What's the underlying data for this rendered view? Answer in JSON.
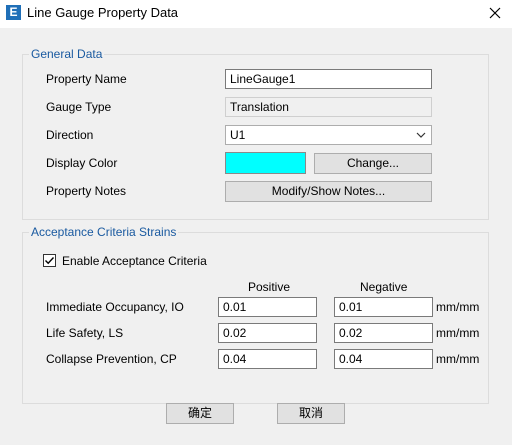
{
  "window": {
    "title": "Line Gauge Property Data",
    "app_icon_letter": "E"
  },
  "general": {
    "legend": "General Data",
    "property_name_label": "Property Name",
    "property_name_value": "LineGauge1",
    "gauge_type_label": "Gauge Type",
    "gauge_type_value": "Translation",
    "direction_label": "Direction",
    "direction_value": "U1",
    "display_color_label": "Display Color",
    "display_color": "#00ffff",
    "change_button": "Change...",
    "property_notes_label": "Property Notes",
    "notes_button": "Modify/Show Notes..."
  },
  "acceptance": {
    "legend": "Acceptance Criteria Strains",
    "enable_label": "Enable Acceptance Criteria",
    "enable_checked": true,
    "positive_header": "Positive",
    "negative_header": "Negative",
    "rows": [
      {
        "label": "Immediate Occupancy, IO",
        "positive": "0.01",
        "negative": "0.01",
        "unit": "mm/mm"
      },
      {
        "label": "Life Safety, LS",
        "positive": "0.02",
        "negative": "0.02",
        "unit": "mm/mm"
      },
      {
        "label": "Collapse Prevention, CP",
        "positive": "0.04",
        "negative": "0.04",
        "unit": "mm/mm"
      }
    ]
  },
  "buttons": {
    "ok": "确定",
    "cancel": "取消"
  },
  "icons": {
    "close": "close-icon",
    "dropdown": "chevron-down-icon",
    "check": "checkmark-icon"
  },
  "colors": {
    "legend_text": "#1a5aa0",
    "dialog_bg": "#f0f0f0",
    "app_icon": "#1f6fb8"
  }
}
